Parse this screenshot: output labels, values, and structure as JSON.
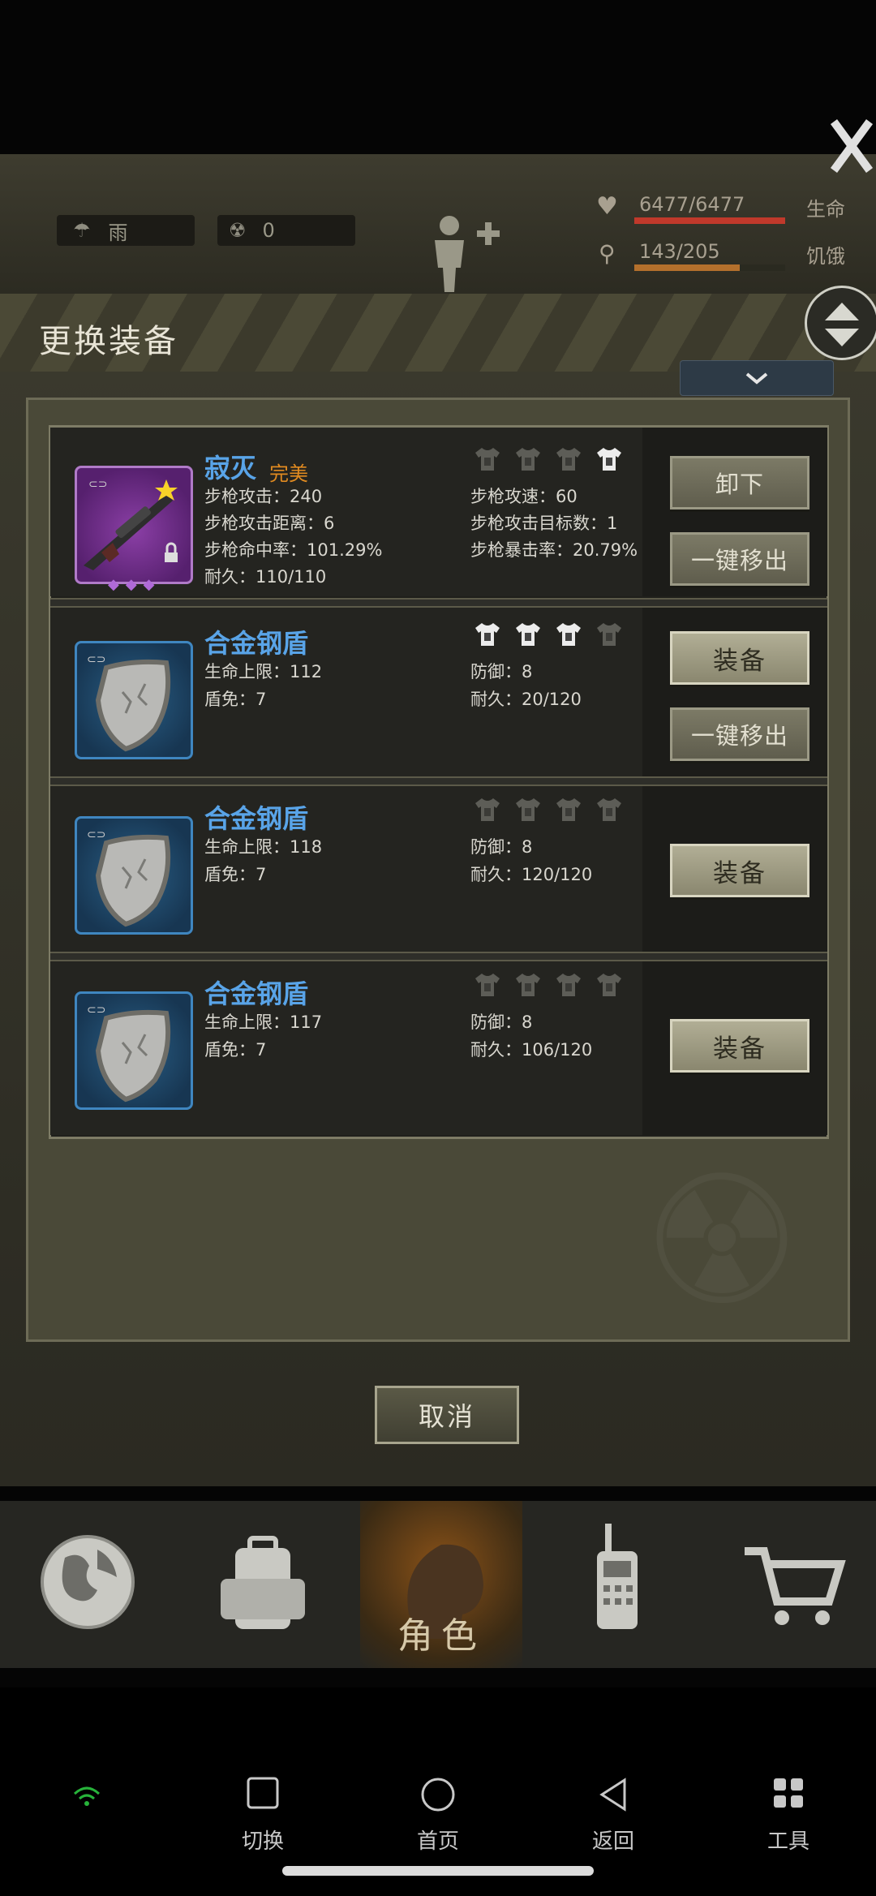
{
  "hud": {
    "weather": "雨",
    "radiation": "0",
    "health": "6477/6477",
    "health_label": "生命",
    "health_fill": 1.0,
    "hunger": "143/205",
    "hunger_label": "饥饿",
    "hunger_fill": 0.7
  },
  "dialog": {
    "title": "更换装备",
    "cancel_label": "取消"
  },
  "items": [
    {
      "name": "寂灭",
      "quality": "完美",
      "icon": "sniper-rifle",
      "stats_left": [
        "步枪攻击：240",
        "步枪攻击距离：6",
        "步枪命中率：101.29%",
        "耐久：110/110"
      ],
      "stats_right": [
        "步枪攻速：60",
        "步枪攻击目标数：1",
        "步枪暴击率：20.79%"
      ],
      "buttons": [
        "卸下",
        "一键移出"
      ],
      "tee_states": [
        false,
        false,
        false,
        true
      ]
    },
    {
      "name": "合金钢盾",
      "quality": "",
      "icon": "steel-shield",
      "stats_left": [
        "生命上限：112",
        "盾免：7"
      ],
      "stats_right": [
        "防御：8",
        "耐久：20/120"
      ],
      "buttons": [
        "装备",
        "一键移出"
      ],
      "tee_states": [
        true,
        true,
        true,
        false
      ]
    },
    {
      "name": "合金钢盾",
      "quality": "",
      "icon": "steel-shield",
      "stats_left": [
        "生命上限：118",
        "盾免：7"
      ],
      "stats_right": [
        "防御：8",
        "耐久：120/120"
      ],
      "buttons": [
        "装备"
      ],
      "tee_states": [
        false,
        false,
        false,
        false
      ]
    },
    {
      "name": "合金钢盾",
      "quality": "",
      "icon": "steel-shield",
      "stats_left": [
        "生命上限：117",
        "盾免：7"
      ],
      "stats_right": [
        "防御：8",
        "耐久：106/120"
      ],
      "buttons": [
        "装备"
      ],
      "tee_states": [
        false,
        false,
        false,
        false
      ]
    }
  ],
  "game_nav": {
    "active_label": "角色",
    "items": [
      "world-globe-icon",
      "backpack-icon",
      "character-icon",
      "radio-icon",
      "shop-cart-icon"
    ]
  },
  "system_nav": {
    "switch": "切换",
    "home": "首页",
    "back": "返回",
    "tools": "工具"
  },
  "colors": {
    "item_name": "#59a4e8",
    "quality_perfect": "#e08a20",
    "health_bar": "#c0392b"
  }
}
